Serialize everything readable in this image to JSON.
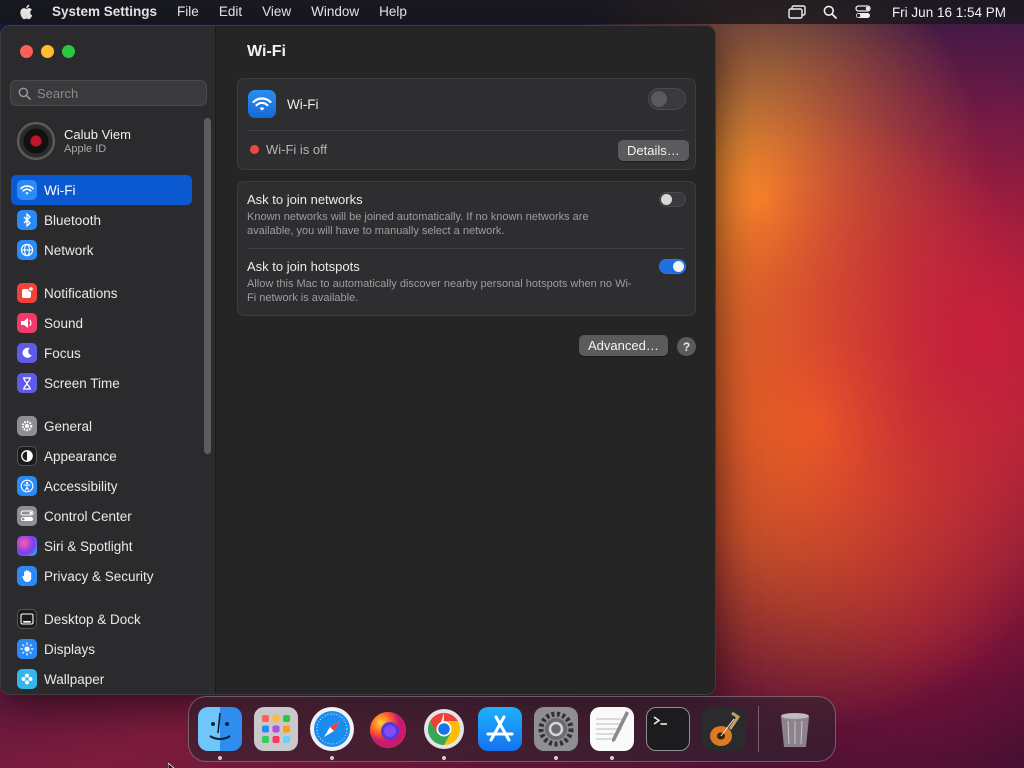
{
  "menubar": {
    "app_name": "System Settings",
    "menus": [
      "File",
      "Edit",
      "View",
      "Window",
      "Help"
    ],
    "clock": "Fri Jun 16  1:54 PM"
  },
  "sidebar": {
    "search_placeholder": "Search",
    "account": {
      "name": "Calub Viem",
      "subtitle": "Apple ID"
    },
    "groups": [
      [
        {
          "label": "Wi-Fi",
          "icon": "wifi-icon",
          "color": "#2a8af6",
          "active": true
        },
        {
          "label": "Bluetooth",
          "icon": "bluetooth-icon",
          "color": "#2a8af6"
        },
        {
          "label": "Network",
          "icon": "globe-icon",
          "color": "#2a8af6"
        }
      ],
      [
        {
          "label": "Notifications",
          "icon": "bell-icon",
          "color": "#f0423a"
        },
        {
          "label": "Sound",
          "icon": "speaker-icon",
          "color": "#ef3a6a"
        },
        {
          "label": "Focus",
          "icon": "moon-icon",
          "color": "#5e5ce6"
        },
        {
          "label": "Screen Time",
          "icon": "hourglass-icon",
          "color": "#5e5ce6"
        }
      ],
      [
        {
          "label": "General",
          "icon": "gear-icon",
          "color": "#8e8e93"
        },
        {
          "label": "Appearance",
          "icon": "appearance-icon",
          "color": "#1c1c1e"
        },
        {
          "label": "Accessibility",
          "icon": "accessibility-icon",
          "color": "#2a8af6"
        },
        {
          "label": "Control Center",
          "icon": "control-center-icon",
          "color": "#8e8e93"
        },
        {
          "label": "Siri & Spotlight",
          "icon": "siri-icon",
          "color": "#b33fd6"
        },
        {
          "label": "Privacy & Security",
          "icon": "hand-icon",
          "color": "#2a8af6"
        }
      ],
      [
        {
          "label": "Desktop & Dock",
          "icon": "dock-icon",
          "color": "#1c1c1e"
        },
        {
          "label": "Displays",
          "icon": "sun-icon",
          "color": "#2a8af6"
        },
        {
          "label": "Wallpaper",
          "icon": "wallpaper-icon",
          "color": "#36b6e8"
        }
      ]
    ]
  },
  "content": {
    "title": "Wi-Fi",
    "wifi_row": {
      "label": "Wi-Fi",
      "enabled": false
    },
    "status": {
      "text": "Wi-Fi is off",
      "dot_color": "#ed4a3f"
    },
    "details_button": "Details…",
    "ask_networks": {
      "title": "Ask to join networks",
      "description": "Known networks will be joined automatically. If no known networks are available, you will have to manually select a network.",
      "enabled": false
    },
    "ask_hotspots": {
      "title": "Ask to join hotspots",
      "description": "Allow this Mac to automatically discover nearby personal hotspots when no Wi-Fi network is available.",
      "enabled": true
    },
    "advanced_button": "Advanced…",
    "help_button": "?"
  },
  "dock": {
    "apps": [
      {
        "name": "Finder",
        "icon": "finder-icon",
        "running": true
      },
      {
        "name": "Launchpad",
        "icon": "launchpad-icon",
        "running": false
      },
      {
        "name": "Safari",
        "icon": "safari-icon",
        "running": true
      },
      {
        "name": "Firefox",
        "icon": "firefox-icon",
        "running": false
      },
      {
        "name": "Chrome",
        "icon": "chrome-icon",
        "running": true
      },
      {
        "name": "App Store",
        "icon": "app-store-icon",
        "running": false
      },
      {
        "name": "System Settings",
        "icon": "system-settings-icon",
        "running": true
      },
      {
        "name": "TextEdit",
        "icon": "textedit-icon",
        "running": true
      },
      {
        "name": "Terminal",
        "icon": "terminal-icon",
        "running": false
      },
      {
        "name": "GarageBand",
        "icon": "garageband-icon",
        "running": false
      }
    ],
    "trash": {
      "name": "Trash",
      "icon": "trash-icon"
    }
  }
}
